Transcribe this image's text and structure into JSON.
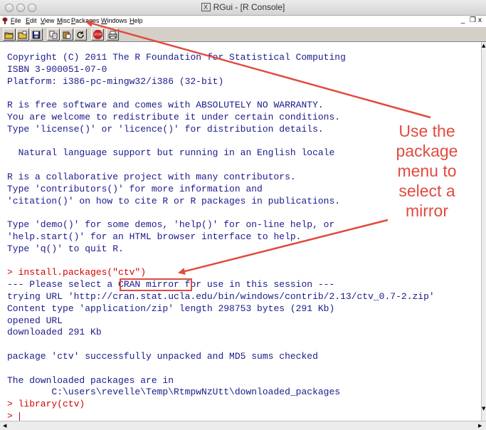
{
  "window": {
    "title": "RGui - [R Console]",
    "x_badge": "X"
  },
  "menubar": {
    "items": [
      "File",
      "Edit",
      "View",
      "Misc",
      "Packages",
      "Windows",
      "Help"
    ],
    "window_controls": [
      "_",
      " ❐",
      "x"
    ]
  },
  "toolbar": {
    "buttons": [
      {
        "name": "open-script-icon",
        "glyph": "❒"
      },
      {
        "name": "load-workspace-icon",
        "glyph": "⎗"
      },
      {
        "name": "save-workspace-icon",
        "glyph": "▣"
      },
      {
        "name": "copy-icon",
        "glyph": "❐"
      },
      {
        "name": "paste-icon",
        "glyph": "⎘"
      },
      {
        "name": "copy-paste-icon",
        "glyph": "↻"
      },
      {
        "name": "stop-icon",
        "glyph": "STOP"
      },
      {
        "name": "print-icon",
        "glyph": "⎙"
      }
    ]
  },
  "console": {
    "lines": [
      {
        "text": "Copyright (C) 2011 The R Foundation for Statistical Computing",
        "color": "blue"
      },
      {
        "text": "ISBN 3-900051-07-0",
        "color": "blue"
      },
      {
        "text": "Platform: i386-pc-mingw32/i386 (32-bit)",
        "color": "blue"
      },
      {
        "text": "",
        "color": "blue"
      },
      {
        "text": "R is free software and comes with ABSOLUTELY NO WARRANTY.",
        "color": "blue"
      },
      {
        "text": "You are welcome to redistribute it under certain conditions.",
        "color": "blue"
      },
      {
        "text": "Type 'license()' or 'licence()' for distribution details.",
        "color": "blue"
      },
      {
        "text": "",
        "color": "blue"
      },
      {
        "text": "  Natural language support but running in an English locale",
        "color": "blue"
      },
      {
        "text": "",
        "color": "blue"
      },
      {
        "text": "R is a collaborative project with many contributors.",
        "color": "blue"
      },
      {
        "text": "Type 'contributors()' for more information and",
        "color": "blue"
      },
      {
        "text": "'citation()' on how to cite R or R packages in publications.",
        "color": "blue"
      },
      {
        "text": "",
        "color": "blue"
      },
      {
        "text": "Type 'demo()' for some demos, 'help()' for on-line help, or",
        "color": "blue"
      },
      {
        "text": "'help.start()' for an HTML browser interface to help.",
        "color": "blue"
      },
      {
        "text": "Type 'q()' to quit R.",
        "color": "blue"
      },
      {
        "text": "",
        "color": "blue"
      },
      {
        "text": "> install.packages(\"ctv\")",
        "color": "red"
      },
      {
        "text": "--- Please select a CRAN mirror for use in this session ---",
        "color": "blue"
      },
      {
        "text": "trying URL 'http://cran.stat.ucla.edu/bin/windows/contrib/2.13/ctv_0.7-2.zip'",
        "color": "blue"
      },
      {
        "text": "Content type 'application/zip' length 298753 bytes (291 Kb)",
        "color": "blue"
      },
      {
        "text": "opened URL",
        "color": "blue"
      },
      {
        "text": "downloaded 291 Kb",
        "color": "blue"
      },
      {
        "text": "",
        "color": "blue"
      },
      {
        "text": "package 'ctv' successfully unpacked and MD5 sums checked",
        "color": "blue"
      },
      {
        "text": "",
        "color": "blue"
      },
      {
        "text": "The downloaded packages are in",
        "color": "blue"
      },
      {
        "text": "        C:\\users\\revelle\\Temp\\RtmpwNzUtt\\downloaded_packages",
        "color": "blue"
      },
      {
        "text": "> library(ctv)",
        "color": "red"
      },
      {
        "text": "> ",
        "color": "red"
      }
    ]
  },
  "annotation": {
    "lines": [
      "Use the",
      "package",
      "menu to",
      "select a",
      "mirror"
    ],
    "color": "#e24a3f"
  },
  "colors": {
    "console_text": "#1a1a8c",
    "console_input": "#d40000",
    "annotation": "#e24a3f"
  }
}
